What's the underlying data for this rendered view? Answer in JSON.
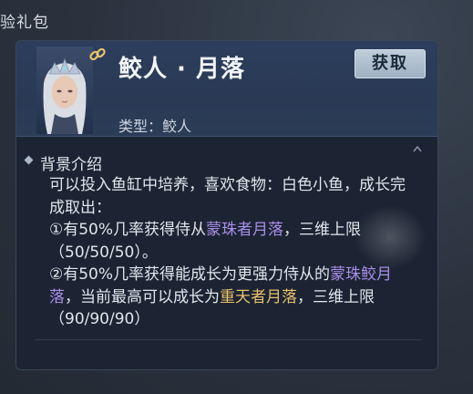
{
  "top_label": "验礼包",
  "item": {
    "name": "鲛人 · 月落",
    "obtain_label": "获取",
    "type_prefix": "类型：",
    "type_value": "鲛人"
  },
  "description": {
    "title": "背景介绍",
    "line1": "可以投入鱼缸中培养，喜欢食物：白色小鱼，成长完成取出：",
    "item1_prefix": "①有50%几率获得侍从",
    "item1_highlight": "蒙珠者月落",
    "item1_suffix": "，三维上限（50/50/50）。",
    "item2_prefix": "②有50%几率获得能成长为更强力侍从的",
    "item2_highlight": "蒙珠鲛月落",
    "item2_middle": "，当前最高可以成长为",
    "item2_highlight2": "重天者月落",
    "item2_suffix": "，三维上限（90/90/90）"
  },
  "icons": {
    "link": "chain-link-icon",
    "scroll": "scroll-up-arrow-icon",
    "bullet": "diamond-bullet-icon"
  },
  "colors": {
    "highlight_purple": "#a98ee8",
    "highlight_gold": "#e8c16a",
    "header_bg": "#2c3e5c"
  }
}
